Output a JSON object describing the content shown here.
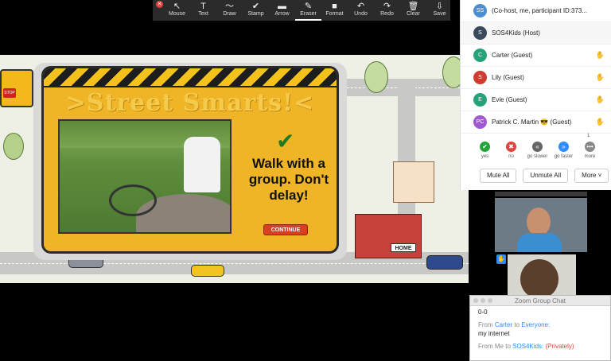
{
  "toolbar": {
    "tools": [
      {
        "label": "Mouse",
        "icon": "cursor-icon",
        "glyph": "↖"
      },
      {
        "label": "Text",
        "icon": "text-icon",
        "glyph": "T"
      },
      {
        "label": "Draw",
        "icon": "draw-icon",
        "glyph": "〜"
      },
      {
        "label": "Stamp",
        "icon": "stamp-icon",
        "glyph": "✔"
      },
      {
        "label": "Arrow",
        "icon": "arrow-icon",
        "glyph": "▬"
      },
      {
        "label": "Eraser",
        "icon": "eraser-icon",
        "glyph": "✎"
      },
      {
        "label": "Format",
        "icon": "format-icon",
        "glyph": "■"
      },
      {
        "label": "Undo",
        "icon": "undo-icon",
        "glyph": "↶"
      },
      {
        "label": "Redo",
        "icon": "redo-icon",
        "glyph": "↷"
      },
      {
        "label": "Clear",
        "icon": "clear-icon",
        "glyph": "🗑"
      },
      {
        "label": "Save",
        "icon": "save-icon",
        "glyph": "⇩"
      }
    ],
    "active_tool": "Eraser"
  },
  "game": {
    "title": ">Street Smarts!<",
    "tip": "Walk with a group. Don't delay!",
    "continue_label": "CONTINUE",
    "home_label": "HOME",
    "stop_label": "STOP"
  },
  "participants": [
    {
      "initials": "SS",
      "name": "(Co-host, me, participant ID:373...",
      "color": "#4a8fd1"
    },
    {
      "initials": "S",
      "name": "SOS4Kids (Host)",
      "color": "#3a4a5c"
    },
    {
      "initials": "C",
      "name": "Carter (Guest)",
      "color": "#27a27a"
    },
    {
      "initials": "S",
      "name": "Lily (Guest)",
      "color": "#d13a2f"
    },
    {
      "initials": "E",
      "name": "Evie (Guest)",
      "color": "#27a27a"
    },
    {
      "initials": "PC",
      "name": "Patrick C. Martin 😎 (Guest)",
      "color": "#a05ad1"
    }
  ],
  "reactions": {
    "count": "1",
    "items": [
      {
        "label": "yes",
        "glyph": "✔",
        "color": "#23a43a",
        "icon": "yes-icon"
      },
      {
        "label": "no",
        "glyph": "✖",
        "color": "#e0443e",
        "icon": "no-icon"
      },
      {
        "label": "go slower",
        "glyph": "«",
        "color": "#666",
        "icon": "go-slower-icon"
      },
      {
        "label": "go faster",
        "glyph": "»",
        "color": "#2d8cff",
        "icon": "go-faster-icon"
      },
      {
        "label": "more",
        "glyph": "•••",
        "color": "#888",
        "icon": "more-icon"
      }
    ]
  },
  "panel_buttons": {
    "mute_all": "Mute All",
    "unmute_all": "Unmute All",
    "more": "More ˅"
  },
  "chat": {
    "title": "Zoom Group Chat",
    "messages": [
      {
        "text": "0-0"
      },
      {
        "from_prefix": "From",
        "from": "Carter",
        "to_word": "to",
        "to": "Everyone:",
        "text": "my internet"
      },
      {
        "from_prefix": "From Me to",
        "to": "SOS4Kids:",
        "private": "(Privately)"
      }
    ]
  }
}
